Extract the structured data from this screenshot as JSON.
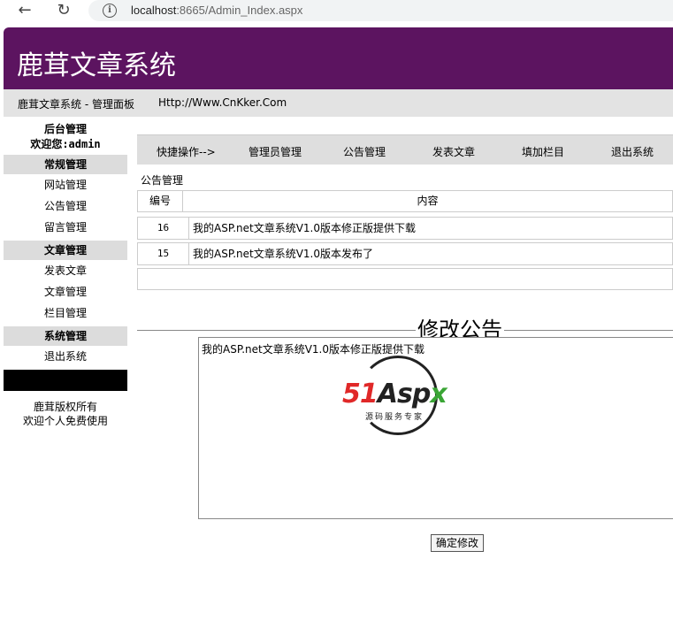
{
  "browser": {
    "back_icon": "back-arrow-icon",
    "reload_icon": "reload-icon",
    "info_icon": "info-icon",
    "url_host": "localhost",
    "url_rest": ":8665/Admin_Index.aspx"
  },
  "header": {
    "title": "鹿茸文章系统",
    "crumb": "鹿茸文章系统 - 管理面板",
    "site_link": "Http://Www.CnKker.Com",
    "bg_color": "#5c1460"
  },
  "sidebar": {
    "heading": "后台管理",
    "welcome": "欢迎您:admin",
    "groups": [
      {
        "title": "常规管理",
        "items": [
          "网站管理",
          "公告管理",
          "留言管理"
        ]
      },
      {
        "title": "文章管理",
        "items": [
          "发表文章",
          "文章管理",
          "栏目管理"
        ]
      },
      {
        "title": "系统管理",
        "items": [
          "退出系统"
        ]
      }
    ],
    "footer_line1": "鹿茸版权所有",
    "footer_line2": "欢迎个人免费使用"
  },
  "quickbar": {
    "items": [
      "快捷操作-->",
      "管理员管理",
      "公告管理",
      "发表文章",
      "填加栏目",
      "退出系统"
    ]
  },
  "notices": {
    "section_label": "公告管理",
    "columns": [
      "编号",
      "内容"
    ],
    "rows": [
      {
        "id": "16",
        "content": "我的ASP.net文章系统V1.0版本修正版提供下载"
      },
      {
        "id": "15",
        "content": "我的ASP.net文章系统V1.0版本发布了"
      }
    ]
  },
  "edit": {
    "title": "修改公告",
    "textarea_value": "我的ASP.net文章系统V1.0版本修正版提供下载",
    "logo_text_red": "51",
    "logo_text_dark": "Asp",
    "logo_text_green": "x",
    "logo_sub": "源码服务专家",
    "submit_label": "确定修改"
  }
}
